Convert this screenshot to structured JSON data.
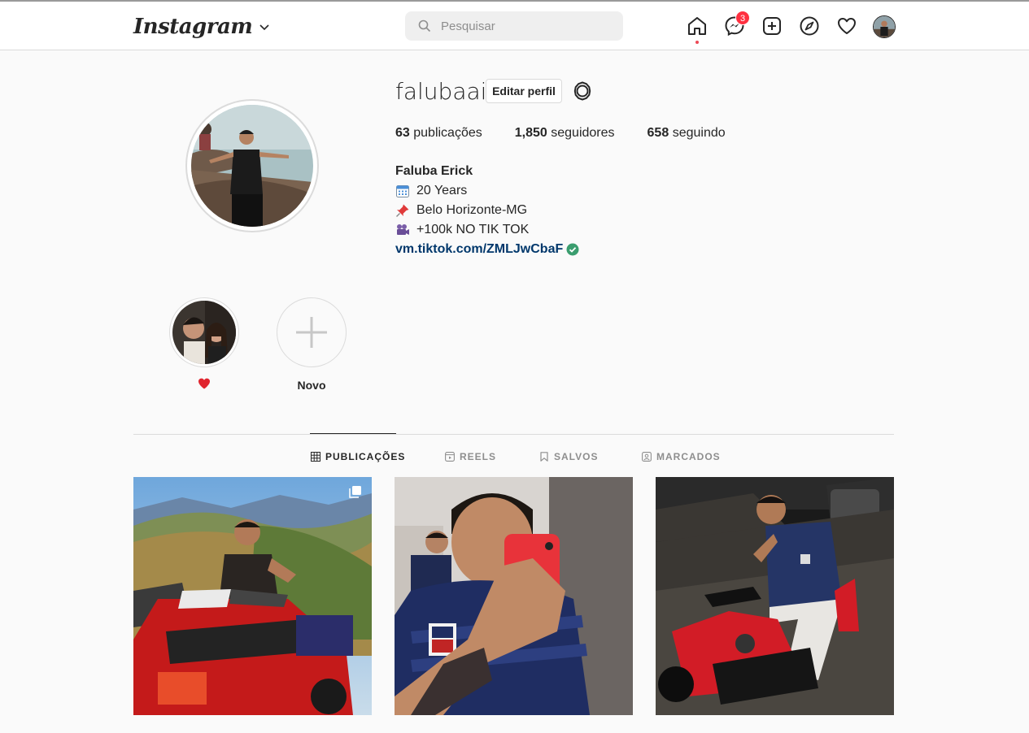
{
  "header": {
    "logo_text": "Instagram",
    "search_placeholder": "Pesquisar",
    "messenger_badge": "3"
  },
  "profile": {
    "username": "falubaai",
    "edit_button": "Editar perfil",
    "stats": [
      {
        "count": "63",
        "label": "publicações"
      },
      {
        "count": "1,850",
        "label": "seguidores"
      },
      {
        "count": "658",
        "label": "seguindo"
      }
    ],
    "full_name": "Faluba Erick",
    "bio_lines": [
      {
        "icon": "calendar-emoji",
        "text": "20 Years"
      },
      {
        "icon": "pushpin-emoji",
        "text": "Belo Horizonte-MG"
      },
      {
        "icon": "movie-camera-emoji",
        "text": "+100k NO TIK TOK"
      }
    ],
    "link": "vm.tiktok.com/ZMLJwCbaF"
  },
  "highlights": [
    {
      "label": "heart-emoji",
      "kind": "story"
    },
    {
      "label": "Novo",
      "kind": "new"
    }
  ],
  "tabs": [
    {
      "label": "PUBLICAÇÕES",
      "icon": "grid-icon",
      "active": true
    },
    {
      "label": "REELS",
      "icon": "reels-icon",
      "active": false
    },
    {
      "label": "SALVOS",
      "icon": "bookmark-icon",
      "active": false
    },
    {
      "label": "MARCADOS",
      "icon": "tagged-icon",
      "active": false
    }
  ],
  "posts": [
    {
      "subject": "quad-bike-mountains",
      "multi": true
    },
    {
      "subject": "mirror-selfie",
      "multi": false
    },
    {
      "subject": "motorcycle-night",
      "multi": false
    }
  ],
  "colors": {
    "notification": "#ff3040",
    "link": "#00376b",
    "verified": "#3a9d6e",
    "border": "#dbdbdb",
    "muted": "#8e8e8e"
  }
}
